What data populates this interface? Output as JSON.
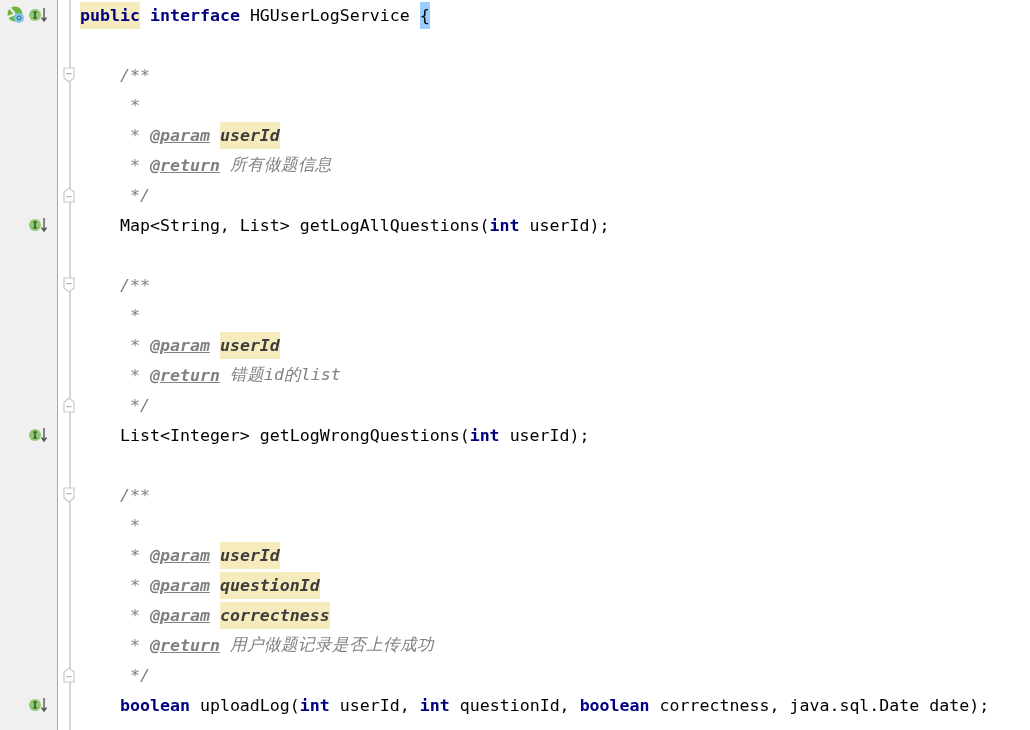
{
  "editor": {
    "lines": [
      {
        "kind": "class-implemented",
        "tokens": [
          {
            "kind": "marked",
            "text": "public"
          },
          {
            "kind": "keyword",
            "text": " interface"
          },
          {
            "kind": "plain",
            "text": " HGUserLogService "
          },
          {
            "kind": "bracket",
            "text": "{"
          }
        ]
      },
      {
        "kind": "blank"
      },
      {
        "kind": "fold-open",
        "tokens": [
          {
            "kind": "comment",
            "text": "    /**"
          }
        ]
      },
      {
        "kind": "plain",
        "tokens": [
          {
            "kind": "comment",
            "text": "     *"
          }
        ]
      },
      {
        "kind": "plain",
        "tokens": [
          {
            "kind": "comment",
            "text": "     * "
          },
          {
            "kind": "doctag",
            "text": "@param "
          },
          {
            "kind": "docparam",
            "text": "userId"
          }
        ]
      },
      {
        "kind": "plain",
        "tokens": [
          {
            "kind": "comment",
            "text": "     * "
          },
          {
            "kind": "doctag",
            "text": "@return"
          },
          {
            "kind": "comment",
            "text": " 所有做题信息"
          }
        ]
      },
      {
        "kind": "fold-close",
        "tokens": [
          {
            "kind": "comment",
            "text": "     */"
          }
        ]
      },
      {
        "kind": "implemented",
        "tokens": [
          {
            "kind": "plain",
            "text": "    Map<String, List> getLogAllQuestions("
          },
          {
            "kind": "keyword",
            "text": "int"
          },
          {
            "kind": "plain",
            "text": " userId);"
          }
        ]
      },
      {
        "kind": "blank"
      },
      {
        "kind": "fold-open",
        "tokens": [
          {
            "kind": "comment",
            "text": "    /**"
          }
        ]
      },
      {
        "kind": "plain",
        "tokens": [
          {
            "kind": "comment",
            "text": "     *"
          }
        ]
      },
      {
        "kind": "plain",
        "tokens": [
          {
            "kind": "comment",
            "text": "     * "
          },
          {
            "kind": "doctag",
            "text": "@param "
          },
          {
            "kind": "docparam",
            "text": "userId"
          }
        ]
      },
      {
        "kind": "plain",
        "tokens": [
          {
            "kind": "comment",
            "text": "     * "
          },
          {
            "kind": "doctag",
            "text": "@return"
          },
          {
            "kind": "comment",
            "text": " 错题id的list"
          }
        ]
      },
      {
        "kind": "fold-close",
        "tokens": [
          {
            "kind": "comment",
            "text": "     */"
          }
        ]
      },
      {
        "kind": "implemented",
        "tokens": [
          {
            "kind": "plain",
            "text": "    List<Integer> getLogWrongQuestions("
          },
          {
            "kind": "keyword",
            "text": "int"
          },
          {
            "kind": "plain",
            "text": " userId);"
          }
        ]
      },
      {
        "kind": "blank"
      },
      {
        "kind": "fold-open",
        "tokens": [
          {
            "kind": "comment",
            "text": "    /**"
          }
        ]
      },
      {
        "kind": "plain",
        "tokens": [
          {
            "kind": "comment",
            "text": "     *"
          }
        ]
      },
      {
        "kind": "plain",
        "tokens": [
          {
            "kind": "comment",
            "text": "     * "
          },
          {
            "kind": "doctag",
            "text": "@param "
          },
          {
            "kind": "docparam",
            "text": "userId"
          }
        ]
      },
      {
        "kind": "plain",
        "tokens": [
          {
            "kind": "comment",
            "text": "     * "
          },
          {
            "kind": "doctag",
            "text": "@param "
          },
          {
            "kind": "docparam",
            "text": "questionId"
          }
        ]
      },
      {
        "kind": "plain",
        "tokens": [
          {
            "kind": "comment",
            "text": "     * "
          },
          {
            "kind": "doctag",
            "text": "@param "
          },
          {
            "kind": "docparam",
            "text": "correctness"
          }
        ]
      },
      {
        "kind": "plain",
        "tokens": [
          {
            "kind": "comment",
            "text": "     * "
          },
          {
            "kind": "doctag",
            "text": "@return"
          },
          {
            "kind": "comment",
            "text": " 用户做题记录是否上传成功"
          }
        ]
      },
      {
        "kind": "fold-close",
        "tokens": [
          {
            "kind": "comment",
            "text": "     */"
          }
        ]
      },
      {
        "kind": "implemented",
        "tokens": [
          {
            "kind": "keyword",
            "text": "    boolean"
          },
          {
            "kind": "plain",
            "text": " uploadLog("
          },
          {
            "kind": "keyword",
            "text": "int"
          },
          {
            "kind": "plain",
            "text": " userId, "
          },
          {
            "kind": "keyword",
            "text": "int"
          },
          {
            "kind": "plain",
            "text": " questionId, "
          },
          {
            "kind": "keyword",
            "text": "boolean"
          },
          {
            "kind": "plain",
            "text": " correctness, java.sql.Date date);"
          }
        ]
      }
    ]
  }
}
